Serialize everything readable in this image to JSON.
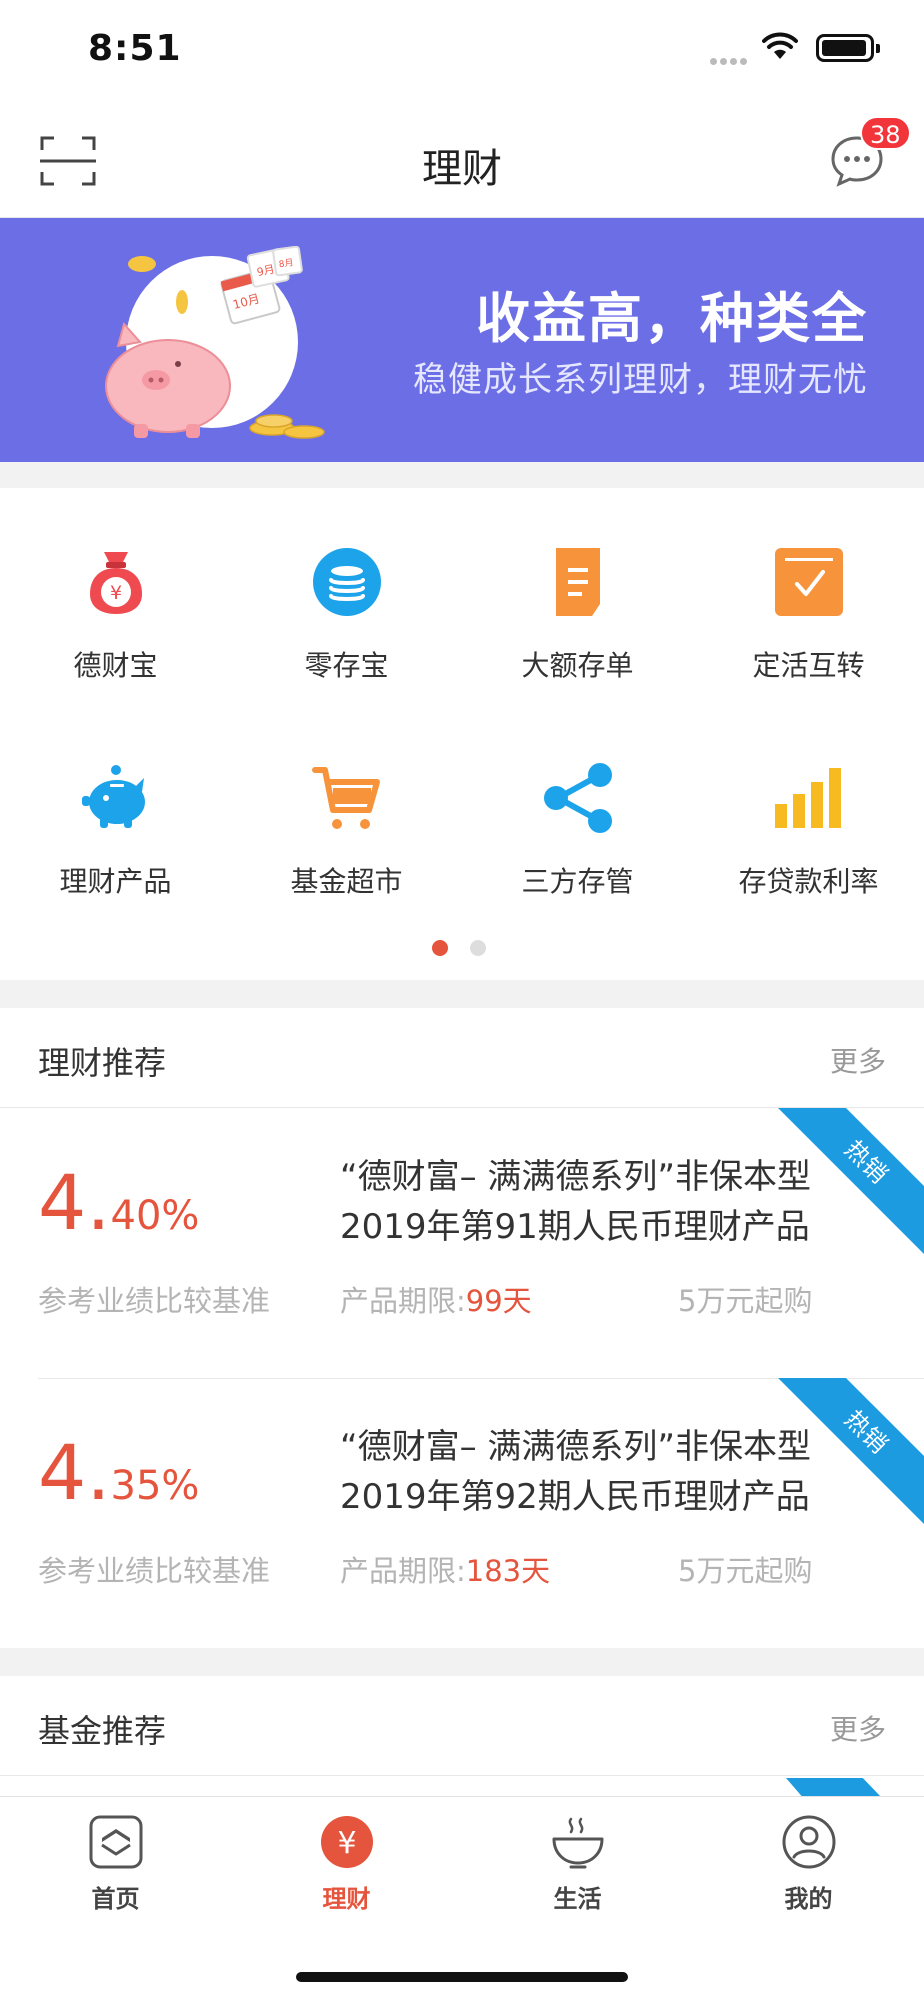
{
  "status": {
    "time": "8:51"
  },
  "header": {
    "title": "理财",
    "message_count": "38"
  },
  "banner": {
    "title": "收益高，种类全",
    "subtitle": "稳健成长系列理财，理财无忧",
    "illustration_text": [
      "10月",
      "9月",
      "8月"
    ]
  },
  "menu": {
    "items": [
      {
        "label": "德财宝",
        "icon": "money-bag-icon"
      },
      {
        "label": "零存宝",
        "icon": "coin-stack-icon"
      },
      {
        "label": "大额存单",
        "icon": "document-icon"
      },
      {
        "label": "定活互转",
        "icon": "check-box-icon"
      },
      {
        "label": "理财产品",
        "icon": "piggy-bank-icon"
      },
      {
        "label": "基金超市",
        "icon": "shopping-cart-icon"
      },
      {
        "label": "三方存管",
        "icon": "share-icon"
      },
      {
        "label": "存贷款利率",
        "icon": "bar-chart-icon"
      }
    ],
    "page_count": 2,
    "current_page": 1
  },
  "wealth_section": {
    "title": "理财推荐",
    "more": "更多",
    "products": [
      {
        "rate_int": "4.",
        "rate_dec": "40%",
        "rate_desc": "参考业绩比较基准",
        "name_line1": "“德财富– 满满德系列”非保本型",
        "name_line2": "2019年第91期人民币理财产品",
        "term_label": "产品期限:",
        "term_value": "99天",
        "min_purchase": "5万元起购",
        "tag": "热销"
      },
      {
        "rate_int": "4.",
        "rate_dec": "35%",
        "rate_desc": "参考业绩比较基准",
        "name_line1": "“德财富– 满满德系列”非保本型",
        "name_line2": "2019年第92期人民币理财产品",
        "term_label": "产品期限:",
        "term_value": "183天",
        "min_purchase": "5万元起购",
        "tag": "热销"
      }
    ]
  },
  "fund_section": {
    "title": "基金推荐",
    "more": "更多"
  },
  "tabbar": {
    "items": [
      {
        "label": "首页",
        "icon": "home-icon"
      },
      {
        "label": "理财",
        "icon": "yuan-icon"
      },
      {
        "label": "生活",
        "icon": "bowl-icon"
      },
      {
        "label": "我的",
        "icon": "user-icon"
      }
    ],
    "active_index": 1
  },
  "colors": {
    "accent": "#e5543c",
    "banner_bg": "#6c6ee6",
    "ribbon": "#1c9be0",
    "badge": "#f2353a",
    "icon_blue": "#1ca3ea",
    "icon_orange": "#f7943b",
    "icon_yellow": "#f7bb21",
    "icon_red": "#ef4a4f"
  }
}
